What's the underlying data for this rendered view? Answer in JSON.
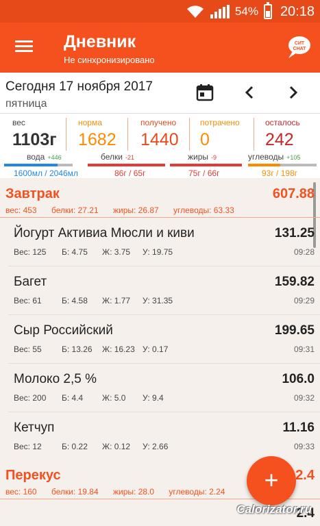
{
  "status": {
    "battery": "54%",
    "time": "20:18"
  },
  "appbar": {
    "title": "Дневник",
    "subtitle": "Не синхронизировано"
  },
  "date": {
    "text": "Сегодня 17 ноября 2017",
    "weekday": "пятница"
  },
  "stats": {
    "weight": {
      "label": "вес",
      "value": "1103г"
    },
    "norm": {
      "label": "норма",
      "value": "1682"
    },
    "received": {
      "label": "получено",
      "value": "1440"
    },
    "spent": {
      "label": "потрачено",
      "value": "0"
    },
    "left": {
      "label": "осталось",
      "value": "242"
    }
  },
  "macros": {
    "water": {
      "label": "вода",
      "delta": "+446",
      "value": "1600мл / 2046мл",
      "progress": 0.78
    },
    "protein": {
      "label": "белки",
      "delta": "-21",
      "value": "86г / 65г",
      "progress": 1.0
    },
    "fat": {
      "label": "жиры",
      "delta": "-9",
      "value": "75г / 66г",
      "progress": 1.0
    },
    "carbs": {
      "label": "углеводы",
      "delta": "+105",
      "value": "93г / 198г",
      "progress": 0.47
    }
  },
  "colors": {
    "accent": "#f4511e",
    "water": "#1e88e5",
    "over": "#e53935",
    "carbs": "#fb8c00",
    "positive": "#43a047"
  },
  "meals": [
    {
      "name": "Завтрак",
      "total": "607.88",
      "weight": "вес: 453",
      "protein": "белки: 27.21",
      "fat": "жиры: 26.87",
      "carbs": "углеводы: 63.33",
      "items": [
        {
          "name": "Йогурт Активиа Мюсли и киви",
          "cal": "131.25",
          "w": "Вес: 125",
          "p": "Б: 4.75",
          "f": "Ж: 3.75",
          "c": "У: 19.75",
          "time": "09:28"
        },
        {
          "name": "Багет",
          "cal": "159.82",
          "w": "Вес: 61",
          "p": "Б: 4.58",
          "f": "Ж: 1.77",
          "c": "У: 31.35",
          "time": "09:29"
        },
        {
          "name": "Сыр Российский",
          "cal": "199.65",
          "w": "Вес: 55",
          "p": "Б: 13.26",
          "f": "Ж: 16.23",
          "c": "У: 0.17",
          "time": "09:31"
        },
        {
          "name": "Молоко 2,5 %",
          "cal": "106.0",
          "w": "Вес: 200",
          "p": "Б: 4.4",
          "f": "Ж: 5.0",
          "c": "У: 9.4",
          "time": "09:32"
        },
        {
          "name": "Кетчуп",
          "cal": "11.16",
          "w": "Вес: 12",
          "p": "Б: 0.22",
          "f": "Ж: 0.12",
          "c": "У: 2.66",
          "time": "09:33"
        }
      ]
    },
    {
      "name": "Перекус",
      "total": "2.4",
      "weight": "вес: 160",
      "protein": "белки: 19.84",
      "fat": "жиры: 28.0",
      "carbs": "углеводы: 2.24"
    }
  ],
  "partial_row": {
    "cal": "2.4"
  },
  "fab": {
    "label": "+"
  },
  "watermark": "Calorizator.ru"
}
